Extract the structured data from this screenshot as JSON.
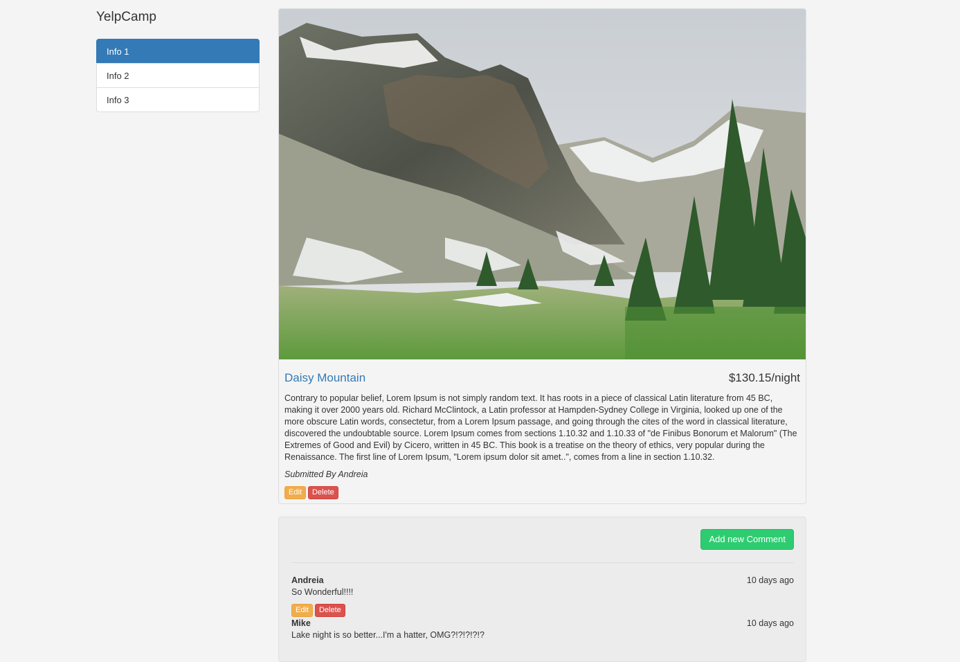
{
  "app": {
    "brand": "YelpCamp"
  },
  "sidebar": {
    "items": [
      {
        "label": "Info 1",
        "active": true
      },
      {
        "label": "Info 2",
        "active": false
      },
      {
        "label": "Info 3",
        "active": false
      }
    ]
  },
  "campground": {
    "name": "Daisy Mountain",
    "price": "$130.15/night",
    "description": "Contrary to popular belief, Lorem Ipsum is not simply random text. It has roots in a piece of classical Latin literature from 45 BC, making it over 2000 years old. Richard McClintock, a Latin professor at Hampden-Sydney College in Virginia, looked up one of the more obscure Latin words, consectetur, from a Lorem Ipsum passage, and going through the cites of the word in classical literature, discovered the undoubtable source. Lorem Ipsum comes from sections 1.10.32 and 1.10.33 of \"de Finibus Bonorum et Malorum\" (The Extremes of Good and Evil) by Cicero, written in 45 BC. This book is a treatise on the theory of ethics, very popular during the Renaissance. The first line of Lorem Ipsum, \"Lorem ipsum dolor sit amet..\", comes from a line in section 1.10.32.",
    "submitted_by": "Submitted By Andreia",
    "edit_label": "Edit",
    "delete_label": "Delete"
  },
  "comments_section": {
    "add_label": "Add new Comment",
    "comments": [
      {
        "author": "Andreia",
        "time": "10 days ago",
        "text": "So Wonderful!!!!",
        "edit_label": "Edit",
        "delete_label": "Delete"
      },
      {
        "author": "Mike",
        "time": "10 days ago",
        "text": "Lake night is so better...I'm a hatter, OMG?!?!?!?!?"
      }
    ]
  },
  "colors": {
    "primary": "#337ab7",
    "warning": "#f0ad4e",
    "danger": "#d9534f",
    "success": "#2ecc71"
  }
}
